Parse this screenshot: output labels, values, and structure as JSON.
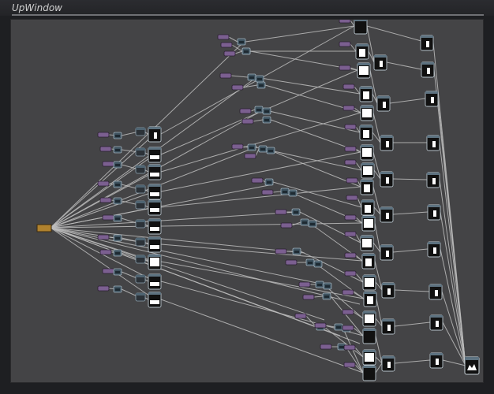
{
  "window": {
    "title": "UpWindow"
  },
  "colors": {
    "canvas": "#444446",
    "wire": "#bdbdbd",
    "param_node": "#7b5f90",
    "small_node": "#3f5360",
    "op_node": "#2c3238",
    "root_node": "#b0822e"
  },
  "node_graph": {
    "root": {
      "name": "root-node",
      "icon": "orange-source-node"
    },
    "node_types": [
      "param-node",
      "small-op-node",
      "image-op-node",
      "output-node"
    ]
  }
}
